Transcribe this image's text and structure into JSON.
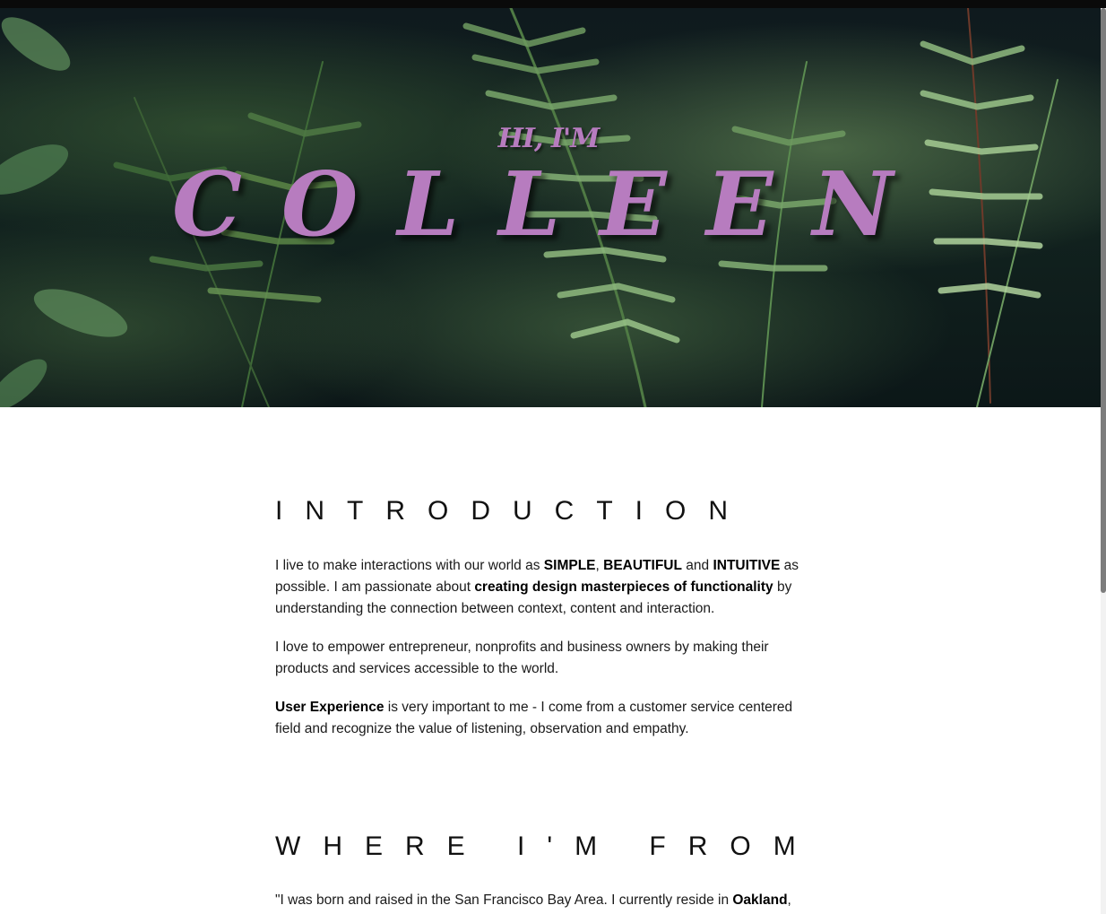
{
  "hero": {
    "greeting": "HI, I'M",
    "name": "COLLEEN"
  },
  "intro": {
    "title": "INTRODUCTION",
    "p1": {
      "t1": "I live to make interactions with our world as ",
      "b1": "SIMPLE",
      "t2": ", ",
      "b2": "BEAUTIFUL",
      "t3": " and ",
      "b3": "INTUITIVE",
      "t4": " as possible. I am passionate about ",
      "b4": "creating design masterpieces of functionality",
      "t5": " by understanding the connection between context, content and interaction."
    },
    "p2": "I love to empower entrepreneur, nonprofits and business owners by making their products and services accessible to the world.",
    "p3": {
      "b1": "User Experience",
      "t1": " is very important to me - I come from a customer service centered field and recognize the value of listening, observation and empathy."
    }
  },
  "where": {
    "title": "WHERE I'M FROM",
    "p1": {
      "t1": "\"I was born and raised in the San Francisco Bay Area. I currently reside in ",
      "b1": "Oakland",
      "t2": ", California."
    }
  },
  "colors": {
    "accent": "#b77cbf",
    "text": "#111111",
    "hero_bg": "#12231f"
  }
}
